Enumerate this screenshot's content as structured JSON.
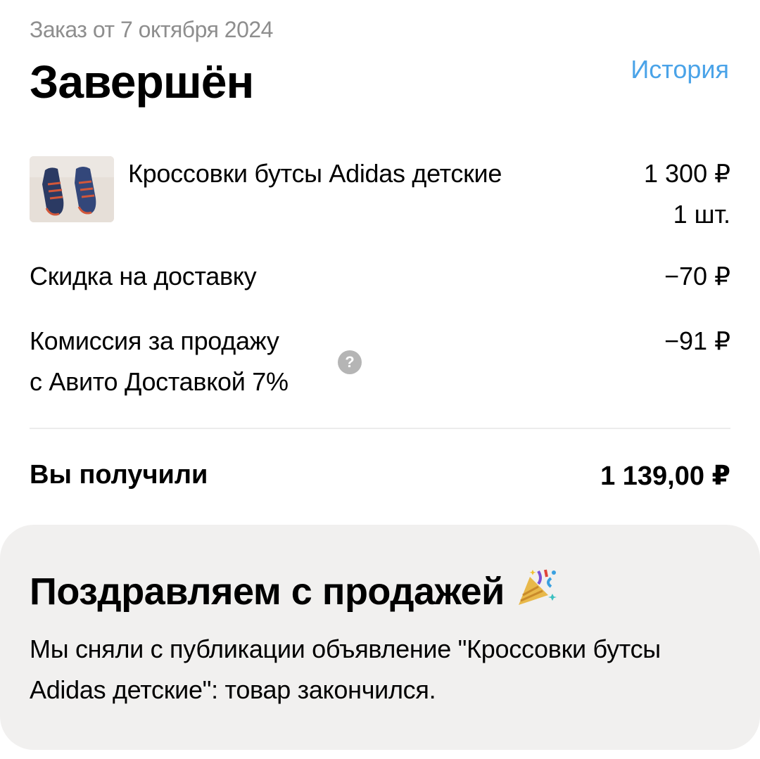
{
  "order": {
    "date_label": "Заказ от 7 октября 2024",
    "status": "Завершён",
    "history_link": "История"
  },
  "product": {
    "image_icon": "sneakers-photo",
    "name": "Кроссовки бутсы Adidas детские",
    "price": "1 300 ₽",
    "quantity": "1 шт."
  },
  "lines": {
    "delivery_discount_label": "Скидка на доставку",
    "delivery_discount_value": "−70 ₽",
    "commission_label_line1": "Комиссия за продажу",
    "commission_label_line2": "с Авито Доставкой 7%",
    "commission_value": "−91 ₽",
    "help_icon": "question-mark-icon",
    "help_symbol": "?"
  },
  "total": {
    "label": "Вы получили",
    "value": "1 139,00 ₽"
  },
  "congrats": {
    "title": "Поздравляем с продажей",
    "icon": "party-popper-icon",
    "text": "Мы сняли с публикации объявление \"Кроссовки бутсы Adidas детские\": товар закончился."
  },
  "colors": {
    "link": "#4aa3e8",
    "muted_text": "#8e8e8e",
    "card_background": "#f1f0ef"
  }
}
